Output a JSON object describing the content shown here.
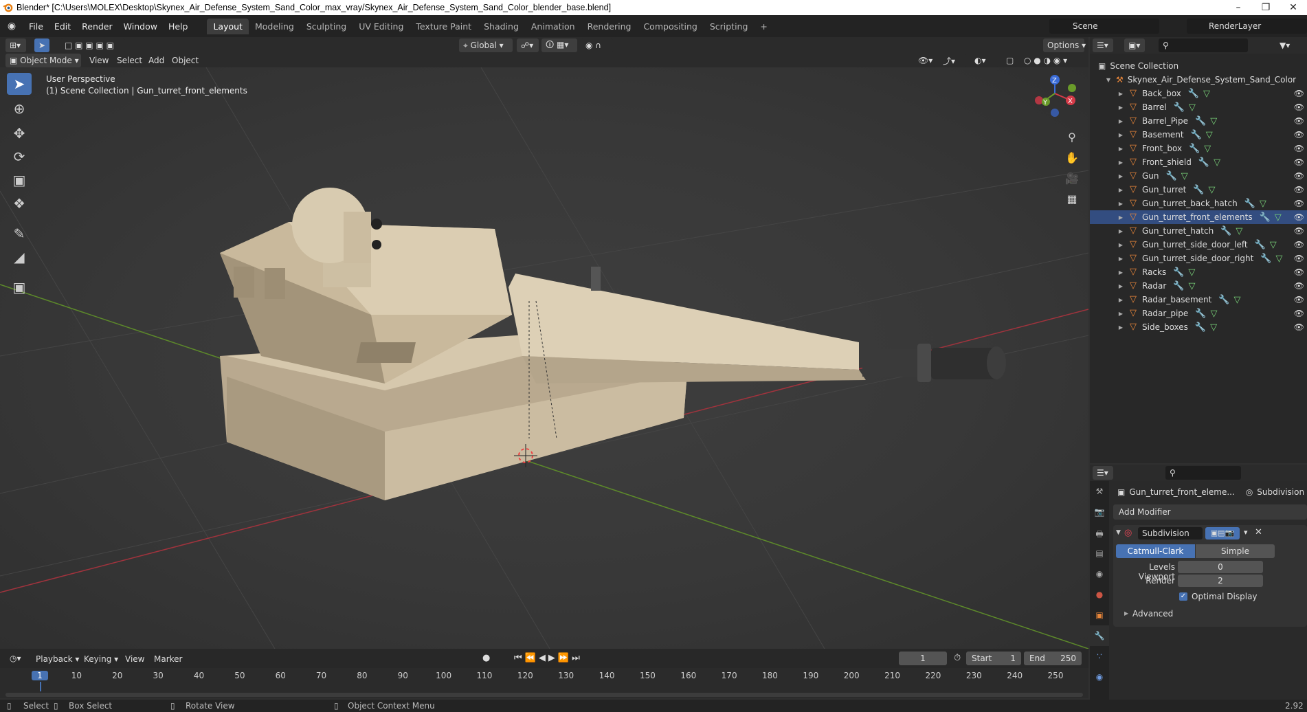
{
  "window": {
    "title": "Blender* [C:\\Users\\MOLEX\\Desktop\\Skynex_Air_Defense_System_Sand_Color_max_vray/Skynex_Air_Defense_System_Sand_Color_blender_base.blend]"
  },
  "menu": {
    "items": [
      "File",
      "Edit",
      "Render",
      "Window",
      "Help"
    ],
    "workspaces": [
      "Layout",
      "Modeling",
      "Sculpting",
      "UV Editing",
      "Texture Paint",
      "Shading",
      "Animation",
      "Rendering",
      "Compositing",
      "Scripting"
    ],
    "add_tab": "+",
    "scene": "Scene",
    "render_layer": "RenderLayer"
  },
  "viewport_header": {
    "mode": "Object Mode",
    "menus": [
      "View",
      "Select",
      "Add",
      "Object"
    ],
    "transform": "Global",
    "options": "Options"
  },
  "viewport": {
    "perspective": "User Perspective",
    "collection_info": "(1) Scene Collection | Gun_turret_front_elements",
    "gizmo": {
      "x": "X",
      "y": "Y",
      "z": "Z"
    },
    "tools": [
      "select-box-icon",
      "cursor-icon",
      "move-icon",
      "rotate-icon",
      "scale-icon",
      "transform-icon",
      "annotate-icon",
      "measure-icon",
      "add-cube-icon"
    ]
  },
  "outliner": {
    "root": "Scene Collection",
    "collection": "Skynex_Air_Defense_System_Sand_Color",
    "items": [
      "Back_box",
      "Barrel",
      "Barrel_Pipe",
      "Basement",
      "Front_box",
      "Front_shield",
      "Gun",
      "Gun_turret",
      "Gun_turret_back_hatch",
      "Gun_turret_front_elements",
      "Gun_turret_hatch",
      "Gun_turret_side_door_left",
      "Gun_turret_side_door_right",
      "Racks",
      "Radar",
      "Radar_basement",
      "Radar_pipe",
      "Side_boxes"
    ],
    "selected": "Gun_turret_front_elements"
  },
  "properties": {
    "object": "Gun_turret_front_eleme...",
    "modifier_tab": "Subdivision",
    "add_modifier": "Add Modifier",
    "modifier": {
      "name": "Subdivision",
      "mode_a": "Catmull-Clark",
      "mode_b": "Simple",
      "levels_label": "Levels Viewport",
      "levels": "0",
      "render_label": "Render",
      "render": "2",
      "optimal": "Optimal Display",
      "advanced": "Advanced"
    }
  },
  "timeline": {
    "menus": [
      "Playback",
      "Keying",
      "View",
      "Marker"
    ],
    "current": "1",
    "start_label": "Start",
    "start": "1",
    "end_label": "End",
    "end": "250",
    "ticks": [
      "1",
      "10",
      "20",
      "30",
      "40",
      "50",
      "60",
      "70",
      "80",
      "90",
      "100",
      "110",
      "120",
      "130",
      "140",
      "150",
      "160",
      "170",
      "180",
      "190",
      "200",
      "210",
      "220",
      "230",
      "240",
      "250"
    ]
  },
  "status": {
    "select": "Select",
    "box": "Box Select",
    "rotate": "Rotate View",
    "context": "Object Context Menu",
    "version": "2.92"
  }
}
